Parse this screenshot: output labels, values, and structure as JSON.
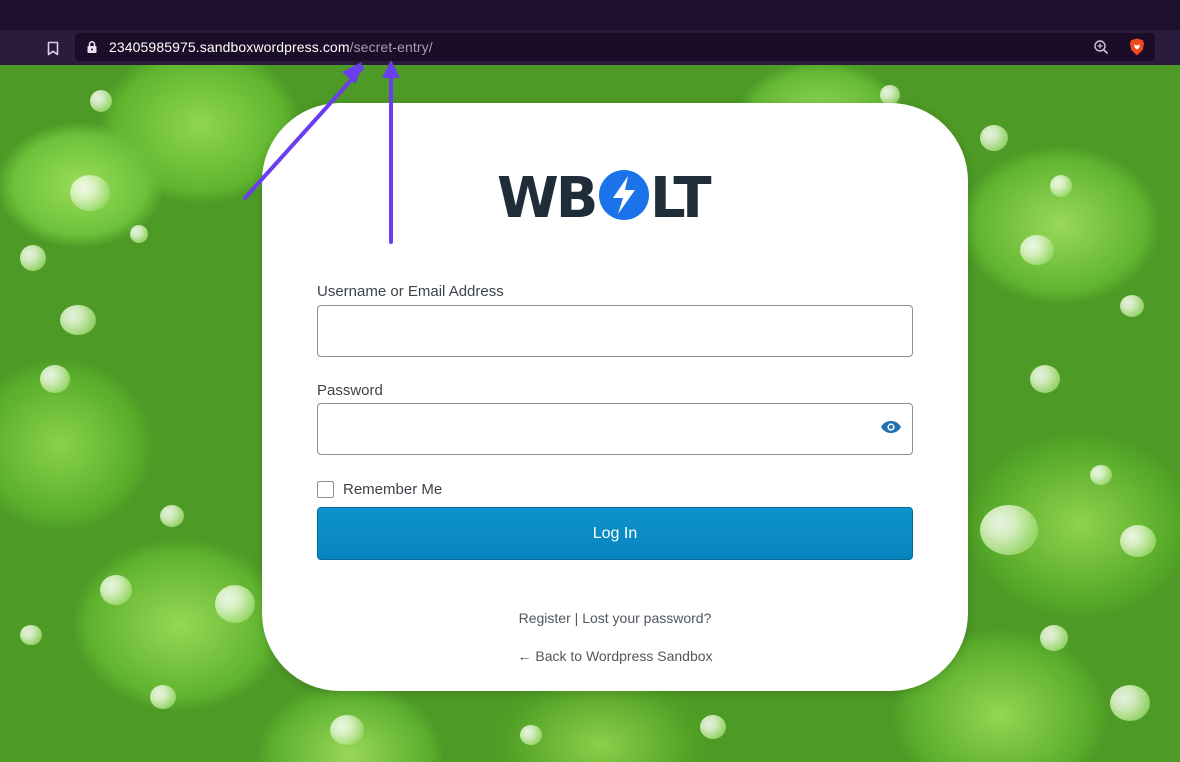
{
  "browser": {
    "url_host": "23405985975.sandboxwordpress.com",
    "url_path": "/secret-entry/",
    "icons": [
      "bookmark-icon",
      "lock-icon",
      "zoom-icon",
      "brave-shield-icon"
    ]
  },
  "logo": {
    "text": "WBOLT",
    "accent_color": "#1a73e8",
    "text_color": "#1f2d3a"
  },
  "form": {
    "username_label": "Username or Email Address",
    "username_value": "",
    "password_label": "Password",
    "password_value": "",
    "remember_label": "Remember Me",
    "remember_checked": false,
    "submit_label": "Log In"
  },
  "links": {
    "register": "Register",
    "separator": "|",
    "lost_password": "Lost your password?",
    "back_to_site": "← Back to Wordpress Sandbox"
  },
  "colors": {
    "button": "#0a8ac3",
    "arrow": "#6b3df0",
    "background": "#5fb52e"
  }
}
